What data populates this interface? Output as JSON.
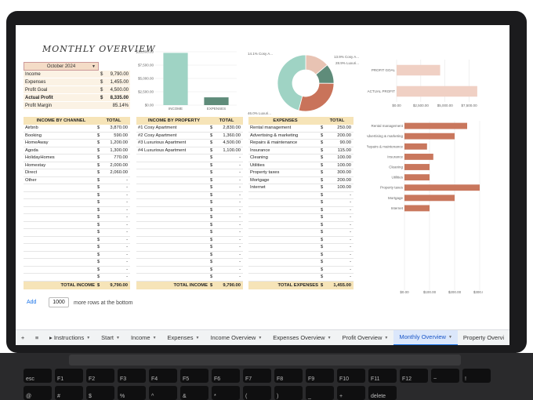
{
  "sheet": {
    "title": "MONTHLY OVERVIEW",
    "month_selector": "October 2024",
    "summary": [
      {
        "label": "Income",
        "cur": "$",
        "value": "9,790.00",
        "bold": false
      },
      {
        "label": "Expenses",
        "cur": "$",
        "value": "1,455.00",
        "bold": false
      },
      {
        "label": "Profit Goal",
        "cur": "$",
        "value": "4,500.00",
        "bold": false
      },
      {
        "label": "Actual Profit",
        "cur": "$",
        "value": "8,335.00",
        "bold": true
      },
      {
        "label": "Profit Margin",
        "cur": "",
        "value": "85.14%",
        "bold": false
      }
    ]
  },
  "income_by_channel": {
    "header": [
      "INCOME BY CHANNEL",
      "TOTAL"
    ],
    "rows": [
      [
        "Airbnb",
        "$",
        "3,870.00"
      ],
      [
        "Booking",
        "$",
        "590.00"
      ],
      [
        "HomeAway",
        "$",
        "1,200.00"
      ],
      [
        "Agoda",
        "$",
        "1,300.00"
      ],
      [
        "HolidayHomes",
        "$",
        "770.00"
      ],
      [
        "Homestay",
        "$",
        "2,000.00"
      ],
      [
        "Direct",
        "$",
        "2,060.00"
      ],
      [
        "Other",
        "$",
        "-"
      ]
    ],
    "empty_row_value": "-",
    "empty_row_cur": "$",
    "footer": [
      "TOTAL INCOME",
      "$",
      "9,790.00"
    ]
  },
  "income_by_property": {
    "header": [
      "INCOME BY PROPERTY",
      "TOTAL"
    ],
    "rows": [
      [
        "#1 Cosy Apartment",
        "$",
        "2,830.00"
      ],
      [
        "#2 Cosy Apartment",
        "$",
        "1,360.00"
      ],
      [
        "#3 Luxurious Apartment",
        "$",
        "4,500.00"
      ],
      [
        "#4 Luxurious Apartment",
        "$",
        "1,100.00"
      ]
    ],
    "empty_row_value": "-",
    "empty_row_cur": "$",
    "footer": [
      "TOTAL INCOME",
      "$",
      "9,790.00"
    ]
  },
  "expenses": {
    "header": [
      "EXPENSES",
      "TOTAL"
    ],
    "rows": [
      [
        "Rental management",
        "$",
        "250.00"
      ],
      [
        "Advertising & marketing",
        "$",
        "200.00"
      ],
      [
        "Repairs & maintenance",
        "$",
        "90.00"
      ],
      [
        "Insurance",
        "$",
        "115.00"
      ],
      [
        "Cleaning",
        "$",
        "100.00"
      ],
      [
        "Utilities",
        "$",
        "100.00"
      ],
      [
        "Property taxes",
        "$",
        "300.00"
      ],
      [
        "Mortgage",
        "$",
        "200.00"
      ],
      [
        "Internet",
        "$",
        "100.00"
      ]
    ],
    "empty_row_value": "-",
    "empty_row_cur": "$",
    "footer": [
      "TOTAL EXPENSES",
      "$",
      "1,455.00"
    ]
  },
  "charts": {
    "income_expenses": {
      "categories": [
        "INCOME",
        "EXPENSES"
      ],
      "y_ticks": [
        "$0.00",
        "$2,500.00",
        "$5,000.00",
        "$7,500.00",
        "$10,000.00"
      ],
      "colors": [
        "#9fd3c4",
        "#5f8c7a"
      ]
    },
    "donut": {
      "labels": [
        "Cosy A...",
        "Luxuri...",
        "Cosy A...",
        "Luxuri..."
      ],
      "pct_labels": [
        "13.9%",
        "28.9%",
        "14.1%",
        "46.0%"
      ],
      "colors": [
        "#e8c3b3",
        "#9fd3c4",
        "#5f8c7a",
        "#c9735a"
      ]
    },
    "profit_goal": {
      "categories": [
        "PROFIT GOAL",
        "ACTUAL PROFIT"
      ],
      "x_ticks": [
        "$0.00",
        "$2,500.00",
        "$5,000.00",
        "$7,500.00"
      ],
      "color": "#f0d0c4"
    },
    "expense_bars": {
      "categories": [
        "Rental management",
        "Advertising & marketing",
        "Repairs & maintenance",
        "Insurance",
        "Cleaning",
        "Utilities",
        "Property taxes",
        "Mortgage",
        "Internet"
      ],
      "x_ticks": [
        "$0.00",
        "$100.00",
        "$200.00",
        "$300.00"
      ],
      "color": "#c9775d"
    }
  },
  "chart_data": [
    {
      "type": "bar",
      "categories": [
        "INCOME",
        "EXPENSES"
      ],
      "values": [
        9790,
        1455
      ],
      "ylim": [
        0,
        10000
      ]
    },
    {
      "type": "pie",
      "categories": [
        "#1 Cosy Apartment",
        "#2 Cosy Apartment",
        "#3 Luxurious Apartment",
        "#4 Luxurious Apartment"
      ],
      "values": [
        2830,
        1360,
        4500,
        1100
      ]
    },
    {
      "type": "bar",
      "categories": [
        "PROFIT GOAL",
        "ACTUAL PROFIT"
      ],
      "values": [
        4500,
        8335
      ],
      "xlim": [
        0,
        8750
      ]
    },
    {
      "type": "bar",
      "categories": [
        "Rental management",
        "Advertising & marketing",
        "Repairs & maintenance",
        "Insurance",
        "Cleaning",
        "Utilities",
        "Property taxes",
        "Mortgage",
        "Internet"
      ],
      "values": [
        250,
        200,
        90,
        115,
        100,
        100,
        300,
        200,
        100
      ],
      "xlim": [
        0,
        300
      ]
    }
  ],
  "bottom": {
    "add_label": "Add",
    "rows_value": "1000",
    "rows_text": "more rows at the bottom"
  },
  "tabs": [
    {
      "label": "+",
      "active": false,
      "dd": false
    },
    {
      "label": "≡",
      "active": false,
      "dd": false
    },
    {
      "label": "▸ Instructions",
      "active": false,
      "dd": true
    },
    {
      "label": "Start",
      "active": false,
      "dd": true
    },
    {
      "label": "Income",
      "active": false,
      "dd": true
    },
    {
      "label": "Expenses",
      "active": false,
      "dd": true
    },
    {
      "label": "Income Overview",
      "active": false,
      "dd": true
    },
    {
      "label": "Expenses Overview",
      "active": false,
      "dd": true
    },
    {
      "label": "Profit Overview",
      "active": false,
      "dd": true
    },
    {
      "label": "Monthly Overview",
      "active": true,
      "dd": true
    },
    {
      "label": "Property Overvi",
      "active": false,
      "dd": false
    }
  ],
  "keyboard": [
    "esc",
    "F1",
    "F2",
    "F3",
    "F4",
    "F5",
    "F6",
    "F7",
    "F8",
    "F9",
    "F10",
    "F11",
    "F12",
    "~",
    "!",
    "@",
    "#",
    "$",
    "%",
    "^",
    "&",
    "*",
    "(",
    ")",
    "_",
    "+",
    "delete"
  ]
}
